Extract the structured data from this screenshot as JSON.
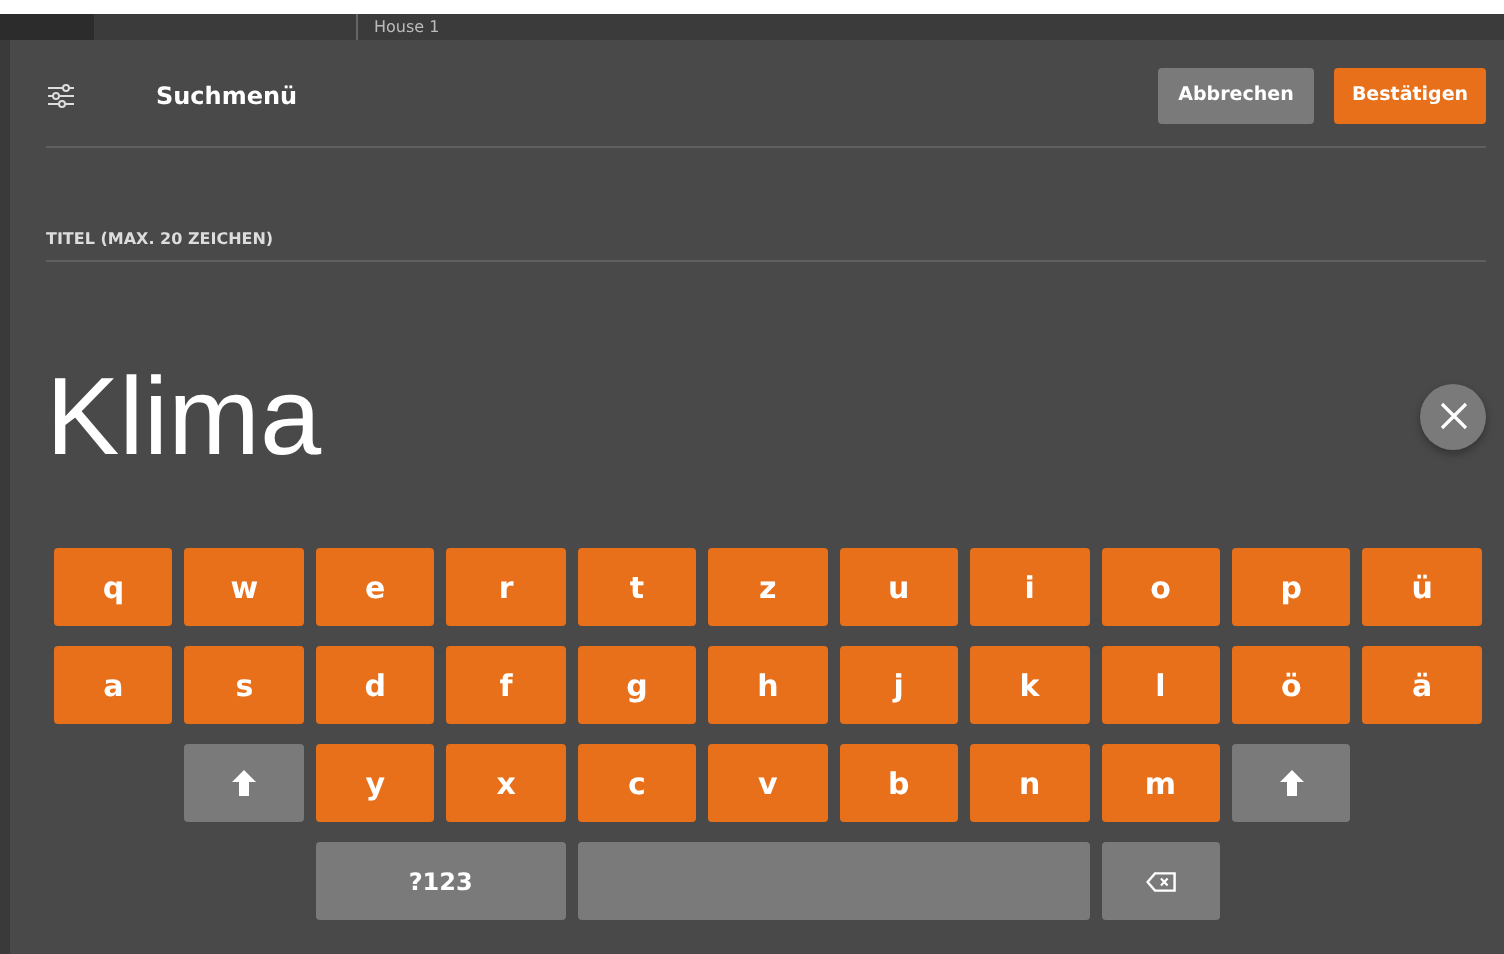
{
  "backdrop": {
    "tab_label": "House 1"
  },
  "dialog": {
    "title": "Suchmenü",
    "buttons": [
      {
        "label": "Abbrechen",
        "kind": "secondary"
      },
      {
        "label": "Bestätigen",
        "kind": "primary"
      }
    ],
    "field": {
      "label": "TITEL (MAX. 20 ZEICHEN)",
      "value": "Klima"
    },
    "keyboard": {
      "rows": [
        [
          {
            "kind": "letter",
            "label": "q"
          },
          {
            "kind": "letter",
            "label": "w"
          },
          {
            "kind": "letter",
            "label": "e"
          },
          {
            "kind": "letter",
            "label": "r"
          },
          {
            "kind": "letter",
            "label": "t"
          },
          {
            "kind": "letter",
            "label": "z"
          },
          {
            "kind": "letter",
            "label": "u"
          },
          {
            "kind": "letter",
            "label": "i"
          },
          {
            "kind": "letter",
            "label": "o"
          },
          {
            "kind": "letter",
            "label": "p"
          },
          {
            "kind": "letter",
            "label": "ü"
          }
        ],
        [
          {
            "kind": "letter",
            "label": "a"
          },
          {
            "kind": "letter",
            "label": "s"
          },
          {
            "kind": "letter",
            "label": "d"
          },
          {
            "kind": "letter",
            "label": "f"
          },
          {
            "kind": "letter",
            "label": "g"
          },
          {
            "kind": "letter",
            "label": "h"
          },
          {
            "kind": "letter",
            "label": "j"
          },
          {
            "kind": "letter",
            "label": "k"
          },
          {
            "kind": "letter",
            "label": "l"
          },
          {
            "kind": "letter",
            "label": "ö"
          },
          {
            "kind": "letter",
            "label": "ä"
          }
        ],
        [
          {
            "kind": "gap"
          },
          {
            "kind": "shift"
          },
          {
            "kind": "letter",
            "label": "y"
          },
          {
            "kind": "letter",
            "label": "x"
          },
          {
            "kind": "letter",
            "label": "c"
          },
          {
            "kind": "letter",
            "label": "v"
          },
          {
            "kind": "letter",
            "label": "b"
          },
          {
            "kind": "letter",
            "label": "n"
          },
          {
            "kind": "letter",
            "label": "m"
          },
          {
            "kind": "shift"
          }
        ],
        [
          {
            "kind": "gap"
          },
          {
            "kind": "gap"
          },
          {
            "kind": "symbols",
            "label": "?123"
          },
          {
            "kind": "space"
          },
          {
            "kind": "backspace"
          }
        ]
      ]
    }
  }
}
